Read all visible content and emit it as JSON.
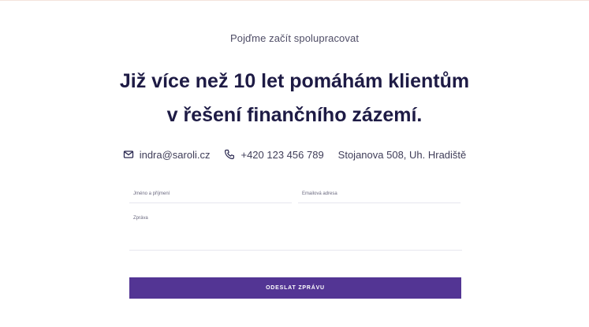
{
  "section": {
    "eyebrow": "Pojďme začít spolupracovat",
    "headline_line1": "Již více než 10 let pomáhám klientům",
    "headline_line2": "v řešení finančního zázemí."
  },
  "contacts": {
    "email": "indra@saroli.cz",
    "phone": "+420 123 456 789",
    "address": "Stojanova 508, Uh. Hradiště"
  },
  "form": {
    "name_label": "Jméno a příjmení",
    "email_label": "Emailová adresa",
    "message_label": "Zpráva",
    "submit_label": "ODESLAT ZPRÁVU"
  },
  "colors": {
    "accent": "#533594",
    "heading": "#1e1b45"
  },
  "icons": {
    "email": "mail-icon",
    "phone": "phone-icon"
  }
}
